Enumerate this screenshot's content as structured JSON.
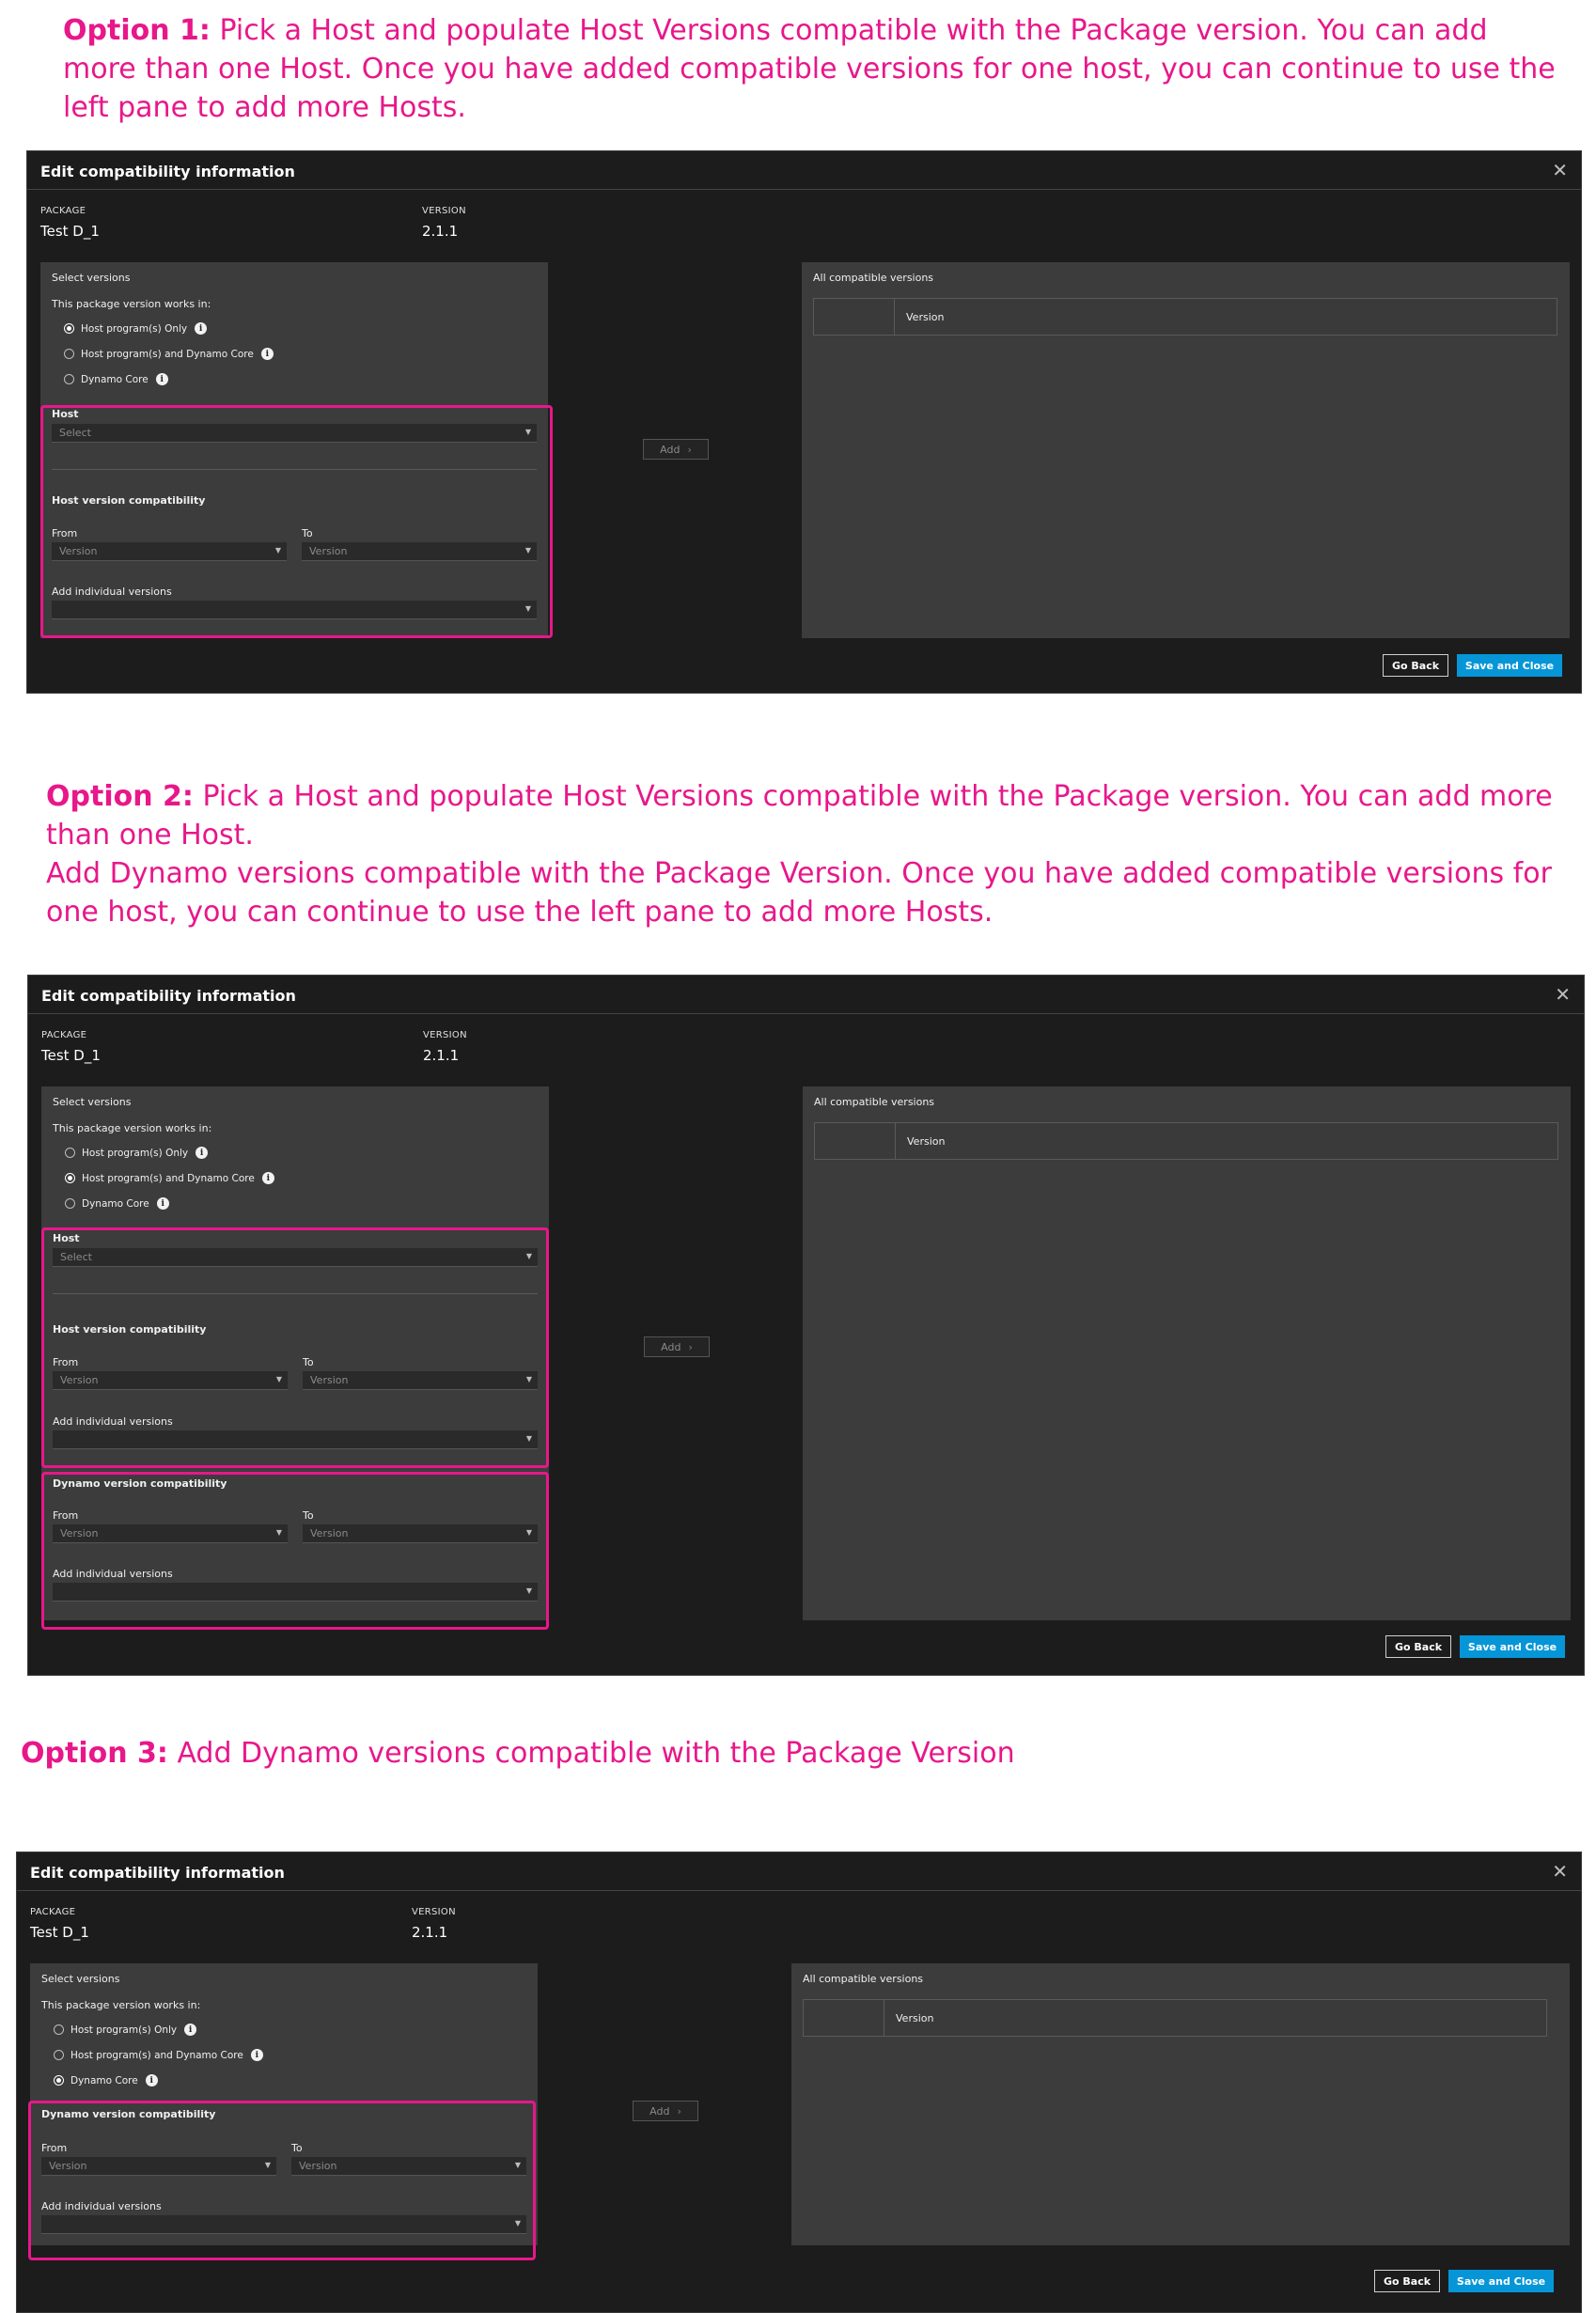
{
  "captions": {
    "option1": {
      "label": "Option 1:",
      "line1": "Pick a Host and populate Host Versions compatible with  the Package version. You can add",
      "line2": "more than one Host. Once you have added  compatible versions for one host, you can continue to use the",
      "line3": "left pane to add more Hosts."
    },
    "option2": {
      "label": "Option 2:",
      "line1": "Pick a Host and populate Host Versions compatible with  the Package version. You can add more",
      "line2": "than one Host.",
      "line3": "Add Dynamo versions compatible with the Package Version. Once you have added  compatible versions for",
      "line4": "one host, you can continue to use the left pane to add more Hosts."
    },
    "option3": {
      "label": "Option 3:",
      "line1": "Add Dynamo  versions compatible with the Package Version"
    }
  },
  "dialog": {
    "title": "Edit compatibility information",
    "close_icon": "close-icon",
    "package_label": "PACKAGE",
    "package_value": "Test D_1",
    "version_label": "VERSION",
    "version_value": "2.1.1",
    "select_versions": "Select versions",
    "works_in": "This package version works in:",
    "radio_host_only": "Host program(s) Only",
    "radio_host_and_core": "Host program(s) and Dynamo Core",
    "radio_core": "Dynamo Core",
    "host_label": "Host",
    "host_placeholder": "Select",
    "host_version_compat": "Host version compatibility",
    "dynamo_version_compat": "Dynamo version compatibility",
    "from_label": "From",
    "to_label": "To",
    "version_placeholder": "Version",
    "add_individual": "Add individual versions",
    "add_button": "Add",
    "all_compatible": "All compatible versions",
    "table_header": "Version",
    "go_back": "Go Back",
    "save_close": "Save and Close"
  },
  "selected_option": {
    "option1": "Host program(s) Only",
    "option2": "Host program(s) and Dynamo Core",
    "option3": "Dynamo Core"
  },
  "colors": {
    "annotation": "#e8178a",
    "dialog_bg": "#1c1c1c",
    "pane_bg": "#3c3c3c",
    "primary_button": "#0696d7"
  }
}
